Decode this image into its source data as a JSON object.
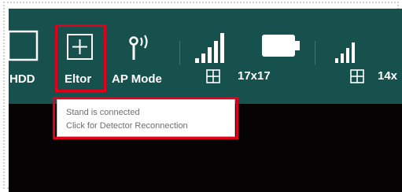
{
  "toolbar": {
    "items": [
      {
        "label": "HDD",
        "icon": "hdd-icon"
      },
      {
        "label": "Eltor",
        "icon": "plus-square-icon"
      },
      {
        "label": "AP Mode",
        "icon": "wifi-antenna-icon"
      },
      {
        "label": "17x17",
        "icon": "signal-bars-icon",
        "sub_icon": "grid-icon"
      },
      {
        "label": "14x",
        "icon": "signal-bars-icon",
        "sub_icon": "grid-icon"
      }
    ],
    "battery_icon": "battery-icon",
    "background": "#16514d"
  },
  "tooltip": {
    "line1": "Stand is connected",
    "line2": "Click for Detector Reconnection"
  },
  "colors": {
    "highlight": "#e0001b",
    "dark_area": "#050304"
  }
}
